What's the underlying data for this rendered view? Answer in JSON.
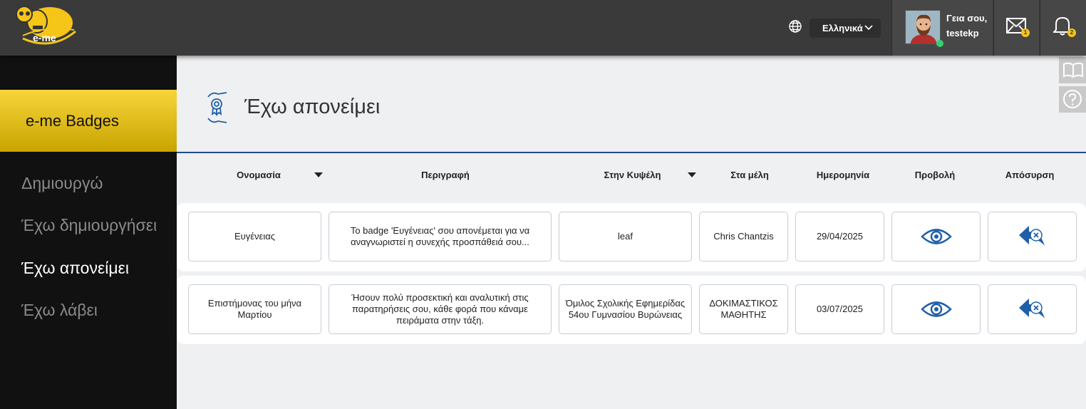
{
  "header": {
    "logo_text": "e-me",
    "language": "Ελληνικά",
    "greeting": "Γεια σου,",
    "username": "testekp",
    "mail_count": "1",
    "notification_count": "2"
  },
  "sidebar": {
    "title": "e-me Badges",
    "items": [
      {
        "label": "Δημιουργώ",
        "active": false
      },
      {
        "label": "Έχω δημιουργήσει",
        "active": false
      },
      {
        "label": "Έχω απονείμει",
        "active": true
      },
      {
        "label": "Έχω λάβει",
        "active": false
      }
    ]
  },
  "page": {
    "title": "Έχω απονείμει"
  },
  "table": {
    "columns": [
      "Ονομασία",
      "Περιγραφή",
      "Στην Κυψέλη",
      "Στα μέλη",
      "Ημερομηνία",
      "Προβολή",
      "Απόσυρση"
    ],
    "rows": [
      {
        "name": "Ευγένειας",
        "description": "Το badge 'Ευγένειας' σου απονέμεται για να αναγνωριστεί η συνεχής προσπάθειά σου...",
        "hive": "leaf",
        "members": "Chris Chantzis",
        "date": "29/04/2025"
      },
      {
        "name": "Επιστήμονας του μήνα Μαρτίου",
        "description": "Ήσουν πολύ προσεκτική και αναλυτική στις παρατηρήσεις σου, κάθε φορά που κάναμε πειράματα στην τάξη.",
        "hive": "Όμιλος Σχολικής Εφημερίδας 54ου Γυμνασίου Βυρώνειας",
        "members": "ΔΟΚΙΜΑΣΤΙΚΟΣ ΜΑΘΗΤΗΣ",
        "date": "03/07/2025"
      }
    ]
  },
  "colors": {
    "accent": "#f5c518",
    "brand_blue": "#1f5fa8",
    "topbar": "#3a3a3a",
    "sidebar": "#111111"
  }
}
